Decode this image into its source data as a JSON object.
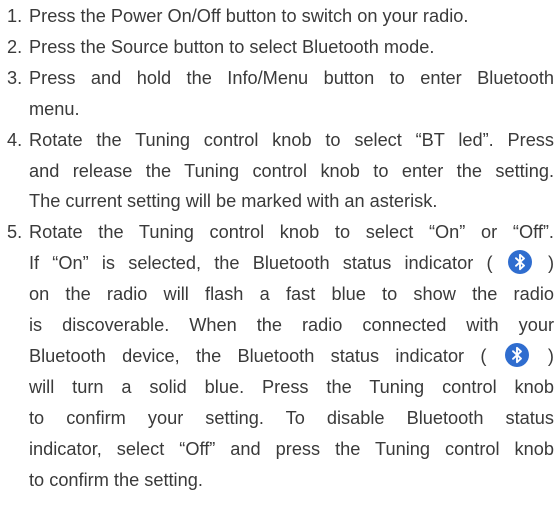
{
  "colors": {
    "text": "#3a3a3a",
    "bluetooth_indicator": "#2f6dcf"
  },
  "steps": [
    {
      "number": "1.",
      "lines": [
        "Press the Power On/Off button to switch on your radio."
      ]
    },
    {
      "number": "2.",
      "lines": [
        "Press the Source button to select Bluetooth mode."
      ]
    },
    {
      "number": "3.",
      "lines": [
        "Press and hold the Info/Menu button to enter Bluetooth",
        "menu."
      ]
    },
    {
      "number": "4.",
      "lines": [
        "Rotate the Tuning control knob to select “BT led”. Press",
        "and release the Tuning control knob to enter the setting.",
        "The current setting will be marked with an asterisk."
      ]
    },
    {
      "number": "5.",
      "lines": [
        "Rotate the Tuning control knob to select “On” or “Off”.",
        "If “On” is selected, the Bluetooth status indicator (",
        ")",
        "on the radio will flash a fast blue to show the radio",
        "is discoverable. When the radio connected with your",
        "Bluetooth device, the Bluetooth status indicator (",
        ")",
        "will turn a solid blue. Press the Tuning control knob",
        "to confirm your setting. To disable Bluetooth status",
        "indicator, select “Off” and press the Tuning control knob",
        "to confirm the setting."
      ]
    }
  ],
  "icons": {
    "bluetooth": "bluetooth-icon"
  }
}
